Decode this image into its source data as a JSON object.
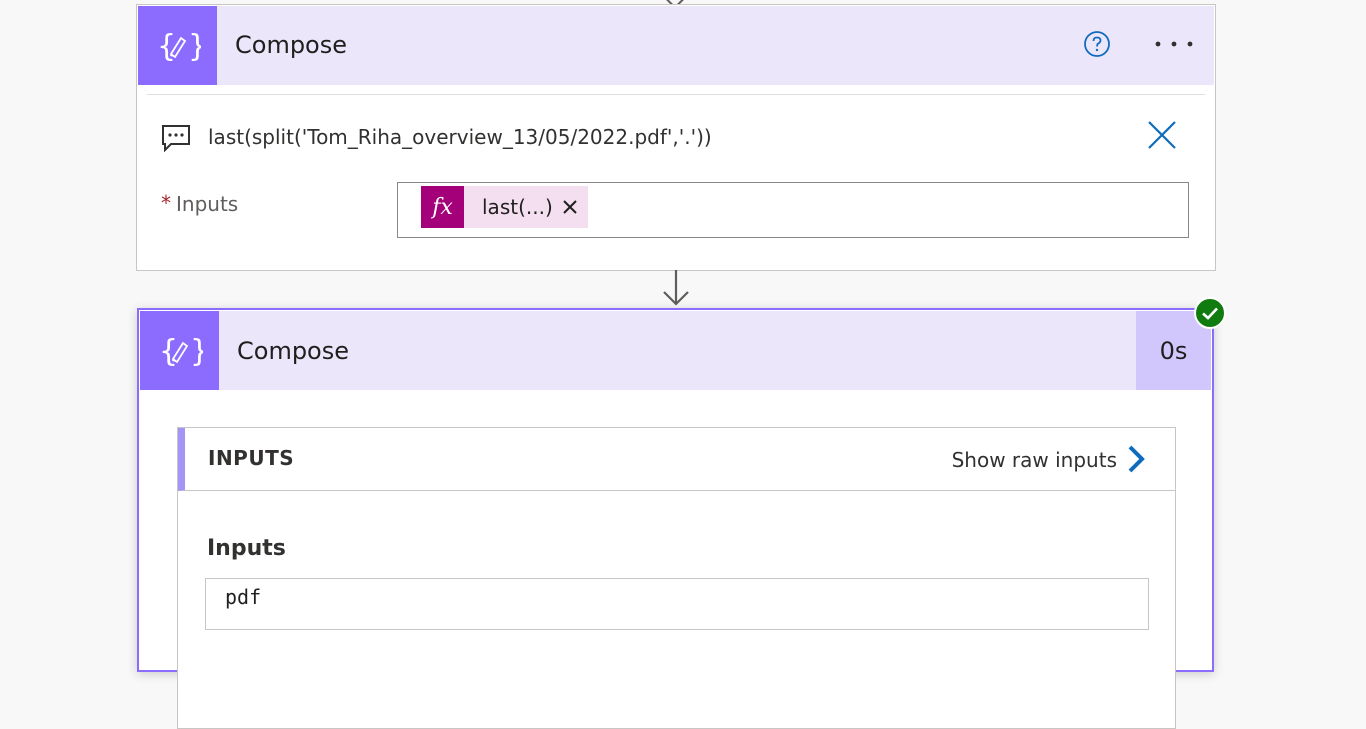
{
  "colors": {
    "accent": "#8c6cff",
    "header_bg": "#ece6fb",
    "token_fx": "#a4007a",
    "success": "#107c10",
    "link_blue": "#0f6cbd"
  },
  "action1": {
    "title": "Compose",
    "expression": "last(split('Tom_Riha_overview_13/05/2022.pdf','.'))",
    "inputs_label": "Inputs",
    "required_marker": "*",
    "token_label": "last(...)",
    "token_icon_text": "fx"
  },
  "action2": {
    "title": "Compose",
    "duration": "0s",
    "inputs_section_title": "INPUTS",
    "show_raw_label": "Show raw inputs",
    "inputs_field_label": "Inputs",
    "inputs_value": "pdf",
    "status": "succeeded"
  }
}
